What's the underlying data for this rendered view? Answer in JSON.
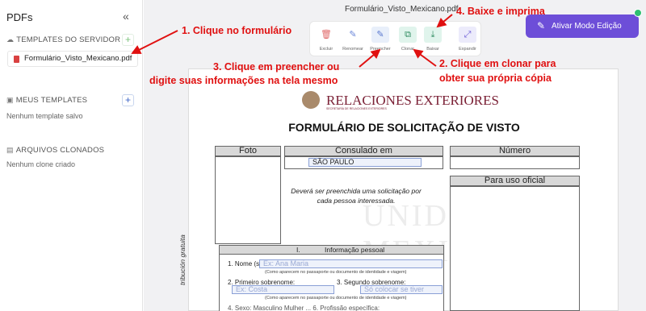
{
  "sidebar": {
    "title": "PDFs",
    "templates_servidor": {
      "label": "TEMPLATES DO SERVIDOR",
      "file": "Formulário_Visto_Mexicano.pdf"
    },
    "meus_templates": {
      "label": "MEUS TEMPLATES",
      "empty": "Nenhum template salvo"
    },
    "arquivos_clonados": {
      "label": "ARQUIVOS CLONADOS",
      "empty": "Nenhum clone criado"
    }
  },
  "main": {
    "doc_title": "Formulário_Visto_Mexicano.pdf",
    "toolbar": {
      "excluir": "Excluir",
      "renomear": "Renomear",
      "preencher": "Preencher",
      "clonar": "Clonar",
      "baixar": "Baixar",
      "expandir": "Expandir"
    },
    "edit_button": "Ativar Modo Edição"
  },
  "document": {
    "agency": "RELACIONES EXTERIORES",
    "agency_sub": "SECRETARÍA DE RELACIONES EXTERIORES",
    "title": "FORMULÁRIO DE SOLICITAÇÃO DE VISTO",
    "foto": "Foto",
    "consulado": "Consulado em",
    "consulado_value": "SÃO PAULO",
    "numero": "Número",
    "uso_oficial": "Para uso oficial",
    "note": "Deverá ser preenchida uma solicitação por cada pessoa interessada.",
    "watermark": "UNIDOS MEXICANOS",
    "vertical_text": "tribución gratuita",
    "section_num": "I.",
    "section_title": "Informação pessoal",
    "nome_label": "1. Nome (s):",
    "nome_placeholder": "Ex: Ana Maria",
    "nome_hint": "(Como aparecem no passaporte ou documento de identidade e viagem)",
    "primeiro_label": "2. Primeiro sobrenome:",
    "primeiro_placeholder": "Ex: Costa",
    "segundo_label": "3. Segundo sobrenome:",
    "segundo_placeholder": "Só colocar se tiver",
    "sobrenome_hint": "(Como aparecem no passaporte ou documento de identidade e viagem)",
    "row4_text": "4. Sexo:     Masculino      Mulher    ...    6. Profissão específica:"
  },
  "annotations": {
    "a1": "1. Clique no formulário",
    "a2_line1": "2. Clique em clonar para",
    "a2_line2": "obter sua própria cópia",
    "a3_line1": "3. Clique em preencher ou",
    "a3_line2": "digite suas informações na tela mesmo",
    "a4": "4. Baixe e imprima"
  },
  "colors": {
    "accent_purple": "#6d4ed8",
    "annotation_red": "#e01010",
    "agency_red": "#7b2136"
  }
}
